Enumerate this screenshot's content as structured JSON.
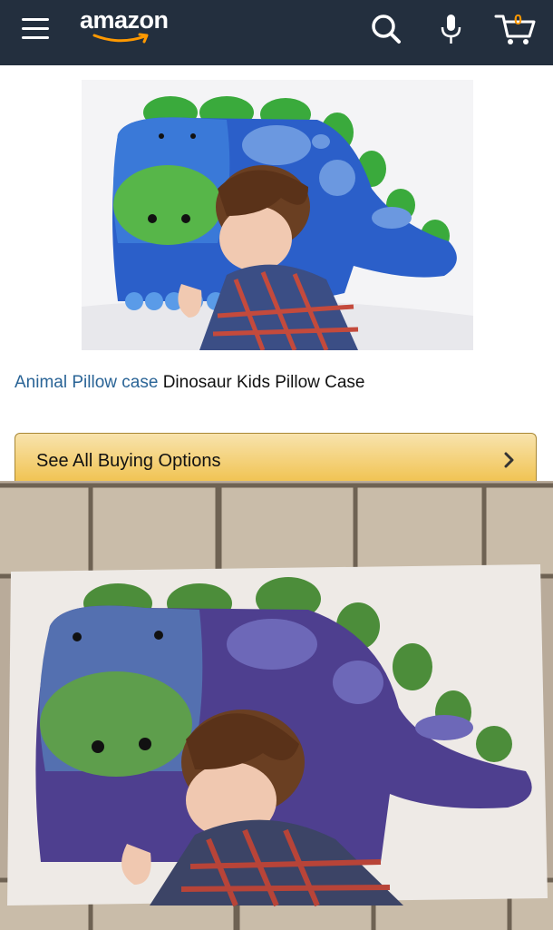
{
  "header": {
    "brand": "amazon",
    "menu_icon": "hamburger-menu-icon",
    "search_icon": "search-icon",
    "mic_icon": "microphone-icon",
    "cart_icon": "cart-icon",
    "cart_count": "0",
    "bg_color": "#232f3e",
    "accent_color": "#f90"
  },
  "product": {
    "category_link": "Animal Pillow case",
    "name": "Dinosaur Kids Pillow Case"
  },
  "actions": {
    "see_all_label": "See All Buying Options",
    "button_color": "#f0c14b"
  }
}
